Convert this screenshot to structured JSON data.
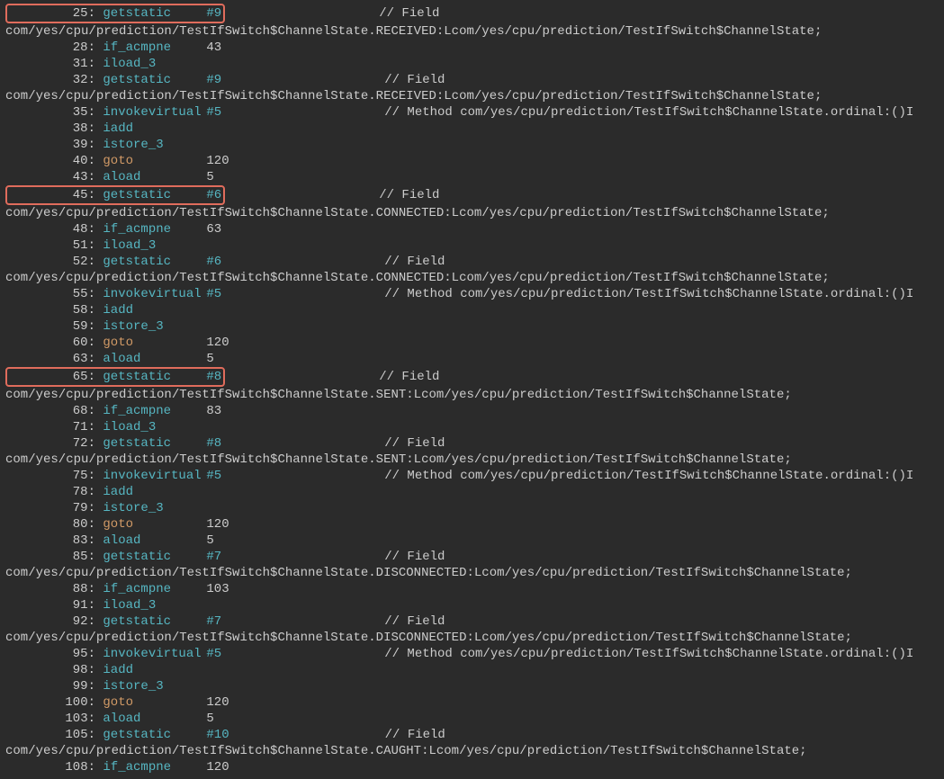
{
  "lines": [
    {
      "ln": "25:",
      "op": "getstatic",
      "opClass": "op",
      "arg": "#9",
      "argClass": "ref",
      "comment": "// Field",
      "indent": 1,
      "highlight": true
    },
    {
      "full": "com/yes/cpu/prediction/TestIfSwitch$ChannelState.RECEIVED:Lcom/yes/cpu/prediction/TestIfSwitch$ChannelState;",
      "indent": 0
    },
    {
      "ln": "28:",
      "op": "if_acmpne",
      "opClass": "op",
      "arg": "43",
      "indent": 1
    },
    {
      "ln": "31:",
      "op": "iload_3",
      "opClass": "op",
      "indent": 1
    },
    {
      "ln": "32:",
      "op": "getstatic",
      "opClass": "op",
      "arg": "#9",
      "argClass": "ref",
      "comment": "// Field",
      "indent": 1
    },
    {
      "full": "com/yes/cpu/prediction/TestIfSwitch$ChannelState.RECEIVED:Lcom/yes/cpu/prediction/TestIfSwitch$ChannelState;",
      "indent": 0
    },
    {
      "ln": "35:",
      "op": "invokevirtual",
      "opClass": "op",
      "arg": "#5",
      "argClass": "ref",
      "comment": "// Method com/yes/cpu/prediction/TestIfSwitch$ChannelState.ordinal:()I",
      "indent": 1
    },
    {
      "ln": "38:",
      "op": "iadd",
      "opClass": "op",
      "indent": 1
    },
    {
      "ln": "39:",
      "op": "istore_3",
      "opClass": "op",
      "indent": 1
    },
    {
      "ln": "40:",
      "op": "goto",
      "opClass": "op-goto",
      "arg": "120",
      "indent": 1
    },
    {
      "ln": "43:",
      "op": "aload",
      "opClass": "op",
      "arg": "5",
      "indent": 1
    },
    {
      "ln": "45:",
      "op": "getstatic",
      "opClass": "op",
      "arg": "#6",
      "argClass": "ref",
      "comment": "// Field",
      "indent": 1,
      "highlight": true
    },
    {
      "full": "com/yes/cpu/prediction/TestIfSwitch$ChannelState.CONNECTED:Lcom/yes/cpu/prediction/TestIfSwitch$ChannelState;",
      "indent": 0
    },
    {
      "ln": "48:",
      "op": "if_acmpne",
      "opClass": "op",
      "arg": "63",
      "indent": 1
    },
    {
      "ln": "51:",
      "op": "iload_3",
      "opClass": "op",
      "indent": 1
    },
    {
      "ln": "52:",
      "op": "getstatic",
      "opClass": "op",
      "arg": "#6",
      "argClass": "ref",
      "comment": "// Field",
      "indent": 1
    },
    {
      "full": "com/yes/cpu/prediction/TestIfSwitch$ChannelState.CONNECTED:Lcom/yes/cpu/prediction/TestIfSwitch$ChannelState;",
      "indent": 0
    },
    {
      "ln": "55:",
      "op": "invokevirtual",
      "opClass": "op",
      "arg": "#5",
      "argClass": "ref",
      "comment": "// Method com/yes/cpu/prediction/TestIfSwitch$ChannelState.ordinal:()I",
      "indent": 1
    },
    {
      "ln": "58:",
      "op": "iadd",
      "opClass": "op",
      "indent": 1
    },
    {
      "ln": "59:",
      "op": "istore_3",
      "opClass": "op",
      "indent": 1
    },
    {
      "ln": "60:",
      "op": "goto",
      "opClass": "op-goto",
      "arg": "120",
      "indent": 1
    },
    {
      "ln": "63:",
      "op": "aload",
      "opClass": "op",
      "arg": "5",
      "indent": 1
    },
    {
      "ln": "65:",
      "op": "getstatic",
      "opClass": "op",
      "arg": "#8",
      "argClass": "ref",
      "comment": "// Field",
      "indent": 1,
      "highlight": true
    },
    {
      "full": "com/yes/cpu/prediction/TestIfSwitch$ChannelState.SENT:Lcom/yes/cpu/prediction/TestIfSwitch$ChannelState;",
      "indent": 0
    },
    {
      "ln": "68:",
      "op": "if_acmpne",
      "opClass": "op",
      "arg": "83",
      "indent": 1
    },
    {
      "ln": "71:",
      "op": "iload_3",
      "opClass": "op",
      "indent": 1
    },
    {
      "ln": "72:",
      "op": "getstatic",
      "opClass": "op",
      "arg": "#8",
      "argClass": "ref",
      "comment": "// Field",
      "indent": 1
    },
    {
      "full": "com/yes/cpu/prediction/TestIfSwitch$ChannelState.SENT:Lcom/yes/cpu/prediction/TestIfSwitch$ChannelState;",
      "indent": 0
    },
    {
      "ln": "75:",
      "op": "invokevirtual",
      "opClass": "op",
      "arg": "#5",
      "argClass": "ref",
      "comment": "// Method com/yes/cpu/prediction/TestIfSwitch$ChannelState.ordinal:()I",
      "indent": 1
    },
    {
      "ln": "78:",
      "op": "iadd",
      "opClass": "op",
      "indent": 1
    },
    {
      "ln": "79:",
      "op": "istore_3",
      "opClass": "op",
      "indent": 1
    },
    {
      "ln": "80:",
      "op": "goto",
      "opClass": "op-goto",
      "arg": "120",
      "indent": 1
    },
    {
      "ln": "83:",
      "op": "aload",
      "opClass": "op",
      "arg": "5",
      "indent": 1
    },
    {
      "ln": "85:",
      "op": "getstatic",
      "opClass": "op",
      "arg": "#7",
      "argClass": "ref",
      "comment": "// Field",
      "indent": 1
    },
    {
      "full": "com/yes/cpu/prediction/TestIfSwitch$ChannelState.DISCONNECTED:Lcom/yes/cpu/prediction/TestIfSwitch$ChannelState;",
      "indent": 0
    },
    {
      "ln": "88:",
      "op": "if_acmpne",
      "opClass": "op",
      "arg": "103",
      "indent": 1
    },
    {
      "ln": "91:",
      "op": "iload_3",
      "opClass": "op",
      "indent": 1
    },
    {
      "ln": "92:",
      "op": "getstatic",
      "opClass": "op",
      "arg": "#7",
      "argClass": "ref",
      "comment": "// Field",
      "indent": 1
    },
    {
      "full": "com/yes/cpu/prediction/TestIfSwitch$ChannelState.DISCONNECTED:Lcom/yes/cpu/prediction/TestIfSwitch$ChannelState;",
      "indent": 0
    },
    {
      "ln": "95:",
      "op": "invokevirtual",
      "opClass": "op",
      "arg": "#5",
      "argClass": "ref",
      "comment": "// Method com/yes/cpu/prediction/TestIfSwitch$ChannelState.ordinal:()I",
      "indent": 1
    },
    {
      "ln": "98:",
      "op": "iadd",
      "opClass": "op",
      "indent": 1
    },
    {
      "ln": "99:",
      "op": "istore_3",
      "opClass": "op",
      "indent": 1
    },
    {
      "ln": "100:",
      "op": "goto",
      "opClass": "op-goto",
      "arg": "120",
      "indent": 1
    },
    {
      "ln": "103:",
      "op": "aload",
      "opClass": "op",
      "arg": "5",
      "indent": 1
    },
    {
      "ln": "105:",
      "op": "getstatic",
      "opClass": "op",
      "arg": "#10",
      "argClass": "ref",
      "comment": "// Field",
      "indent": 1
    },
    {
      "full": "com/yes/cpu/prediction/TestIfSwitch$ChannelState.CAUGHT:Lcom/yes/cpu/prediction/TestIfSwitch$ChannelState;",
      "indent": 0
    },
    {
      "ln": "108:",
      "op": "if_acmpne",
      "opClass": "op",
      "arg": "120",
      "indent": 1
    }
  ],
  "cols": {
    "lnCol": 100,
    "opCol": 115,
    "argCol": 30,
    "commentStart": 420
  }
}
